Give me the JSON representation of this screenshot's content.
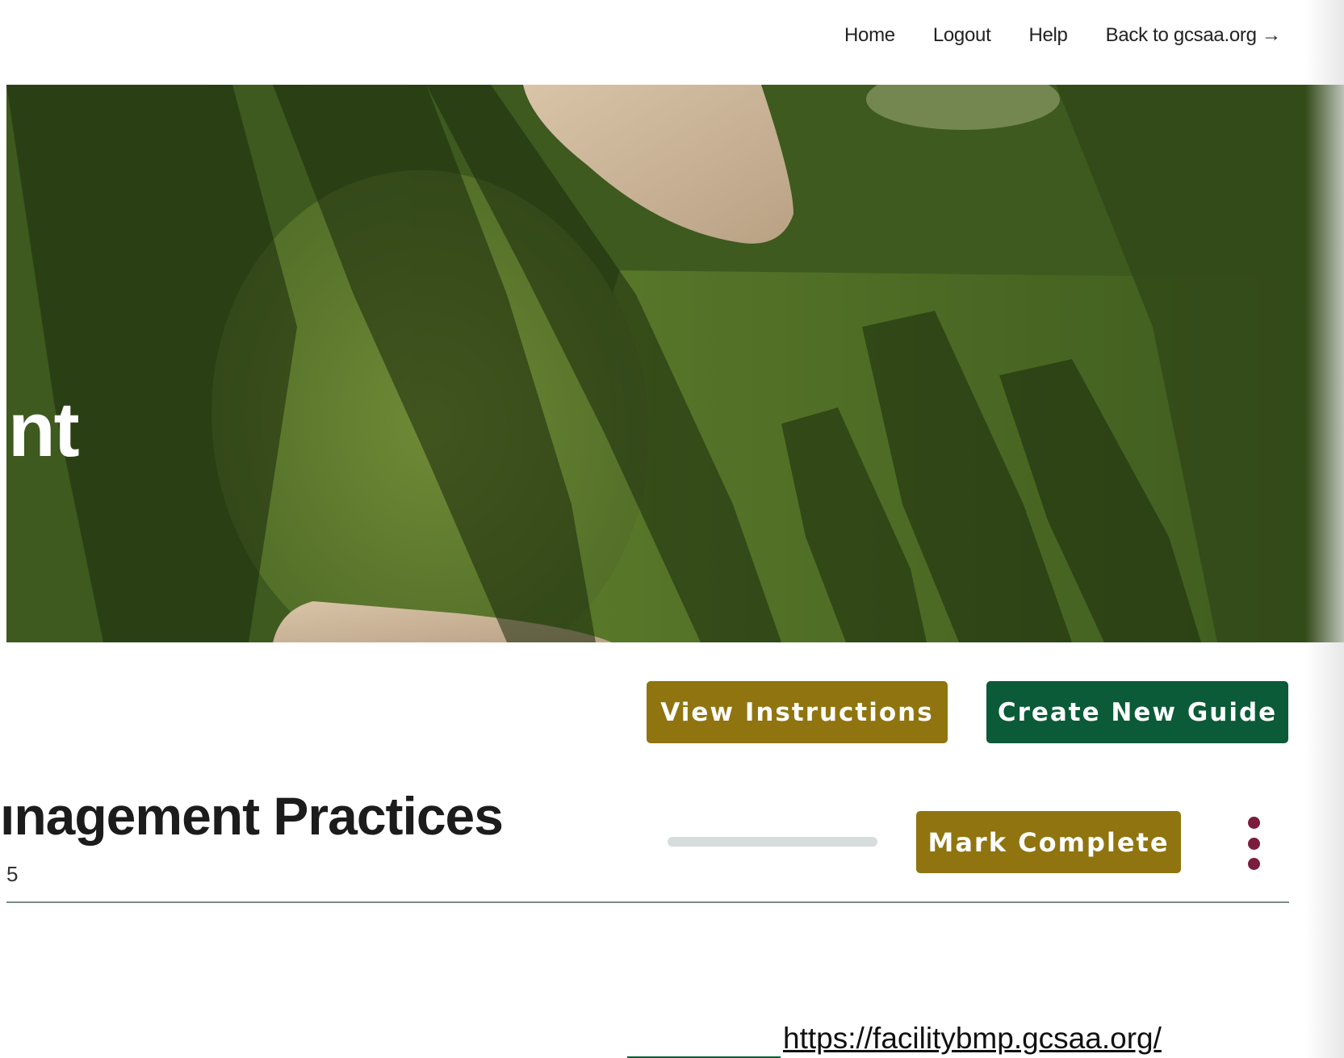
{
  "nav": {
    "items": [
      {
        "label": "Home"
      },
      {
        "label": "Logout"
      },
      {
        "label": "Help"
      },
      {
        "label": "Back to gcsaa.org →"
      }
    ]
  },
  "hero": {
    "title_fragment": "nt"
  },
  "actions": {
    "view_instructions_label": "View Instructions",
    "create_guide_label": "Create New Guide"
  },
  "guide": {
    "title_fragment": "ınagement Practices",
    "subtitle_fragment": "5",
    "progress_fraction": 0,
    "mark_complete_label": "Mark Complete"
  },
  "footer": {
    "url": "https://facilitybmp.gcsaa.org/"
  },
  "colors": {
    "gold": "#8f7410",
    "green": "#0b5a38",
    "kebab": "#7b1d3d",
    "progress_track": "#d7dcdc"
  },
  "icons": {
    "menu": "more-vertical-icon",
    "hero_image": "golf-course-aerial-image"
  }
}
